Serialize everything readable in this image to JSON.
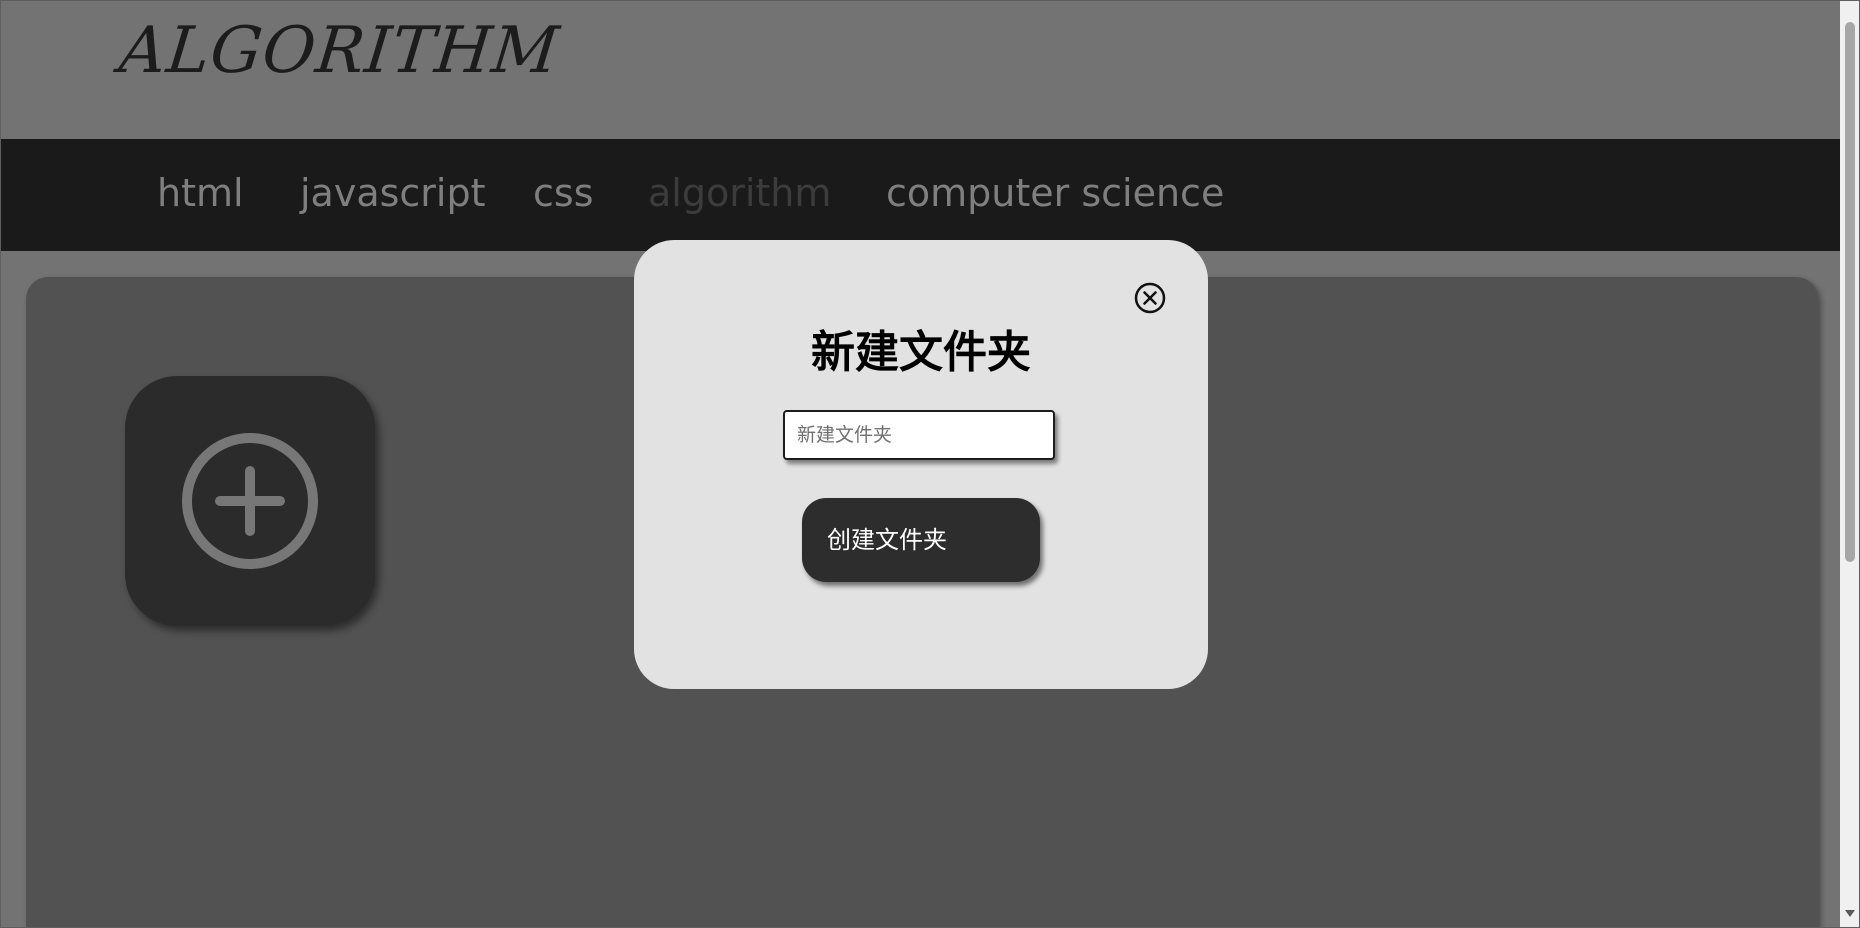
{
  "header": {
    "logo_text": "ALGORITHM"
  },
  "nav": {
    "items": [
      {
        "label": "html",
        "active": false
      },
      {
        "label": "javascript",
        "active": false
      },
      {
        "label": "css",
        "active": false
      },
      {
        "label": "algorithm",
        "active": true
      },
      {
        "label": "computer science",
        "active": false
      }
    ]
  },
  "main": {
    "add_tile_icon": "plus-circle-icon"
  },
  "modal": {
    "close_icon": "close-circle-icon",
    "title": "新建文件夹",
    "input_value": "",
    "input_placeholder": "新建文件夹",
    "create_button_label": "创建文件夹"
  },
  "colors": {
    "header_bg": "#737373",
    "nav_bg": "#1a1a1a",
    "nav_text": "#7f7f7f",
    "nav_active_text": "#3c3c3c",
    "panel_bg": "#525252",
    "tile_bg": "#2b2b2b",
    "modal_bg": "#e2e2e2",
    "button_bg": "#2d2d2d"
  }
}
